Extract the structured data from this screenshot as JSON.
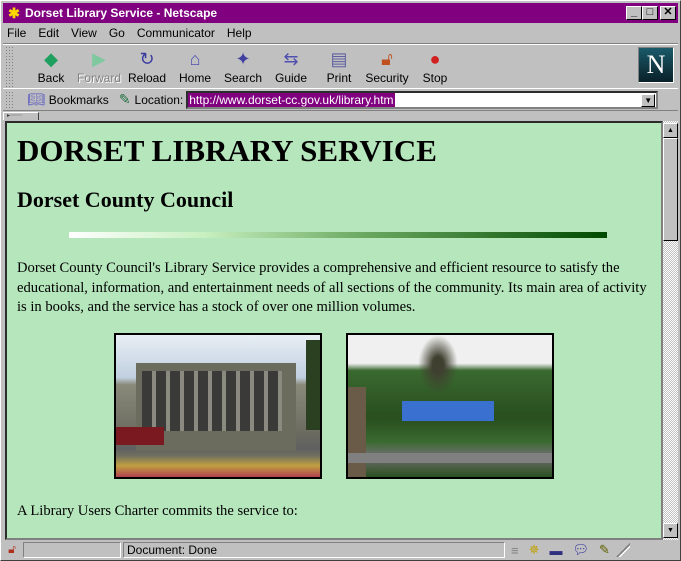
{
  "window": {
    "title": "Dorset Library Service - Netscape",
    "controls": [
      "minimize",
      "maximize",
      "close"
    ]
  },
  "menu": [
    {
      "label": "File",
      "accel": "F"
    },
    {
      "label": "Edit",
      "accel": "E"
    },
    {
      "label": "View",
      "accel": "V"
    },
    {
      "label": "Go",
      "accel": "G"
    },
    {
      "label": "Communicator",
      "accel": "C"
    },
    {
      "label": "Help",
      "accel": "H"
    }
  ],
  "toolbar": {
    "buttons": [
      {
        "label": "Back",
        "icon": "back-arrow-icon",
        "enabled": true
      },
      {
        "label": "Forward",
        "icon": "forward-arrow-icon",
        "enabled": false
      },
      {
        "label": "Reload",
        "icon": "reload-icon",
        "enabled": true
      },
      {
        "label": "Home",
        "icon": "home-icon",
        "enabled": true
      },
      {
        "label": "Search",
        "icon": "search-flashlight-icon",
        "enabled": true
      },
      {
        "label": "Guide",
        "icon": "guide-signpost-icon",
        "enabled": true
      },
      {
        "label": "Print",
        "icon": "printer-icon",
        "enabled": true
      },
      {
        "label": "Security",
        "icon": "padlock-icon",
        "enabled": true
      },
      {
        "label": "Stop",
        "icon": "stop-light-icon",
        "enabled": true
      }
    ],
    "logo": "N"
  },
  "location_bar": {
    "bookmarks_label": "Bookmarks",
    "location_label": "Location:",
    "url": "http://www.dorset-cc.gov.uk/library.htm"
  },
  "page": {
    "heading": "DORSET LIBRARY SERVICE",
    "subheading": "Dorset County Council",
    "intro": "Dorset County Council's Library Service provides a comprehensive and efficient resource to satisfy the educational, information, and entertainment needs of all sections of the community. Its main area of activity is in books, and the service has a stock of over one million volumes.",
    "photos": [
      {
        "description": "Library building photo"
      },
      {
        "description": "Library with blue roof and green hillside photo"
      }
    ],
    "charter_text": "A Library Users Charter commits the service to:",
    "background_color": "#b6e6bc"
  },
  "status_bar": {
    "text": "Document: Done"
  }
}
